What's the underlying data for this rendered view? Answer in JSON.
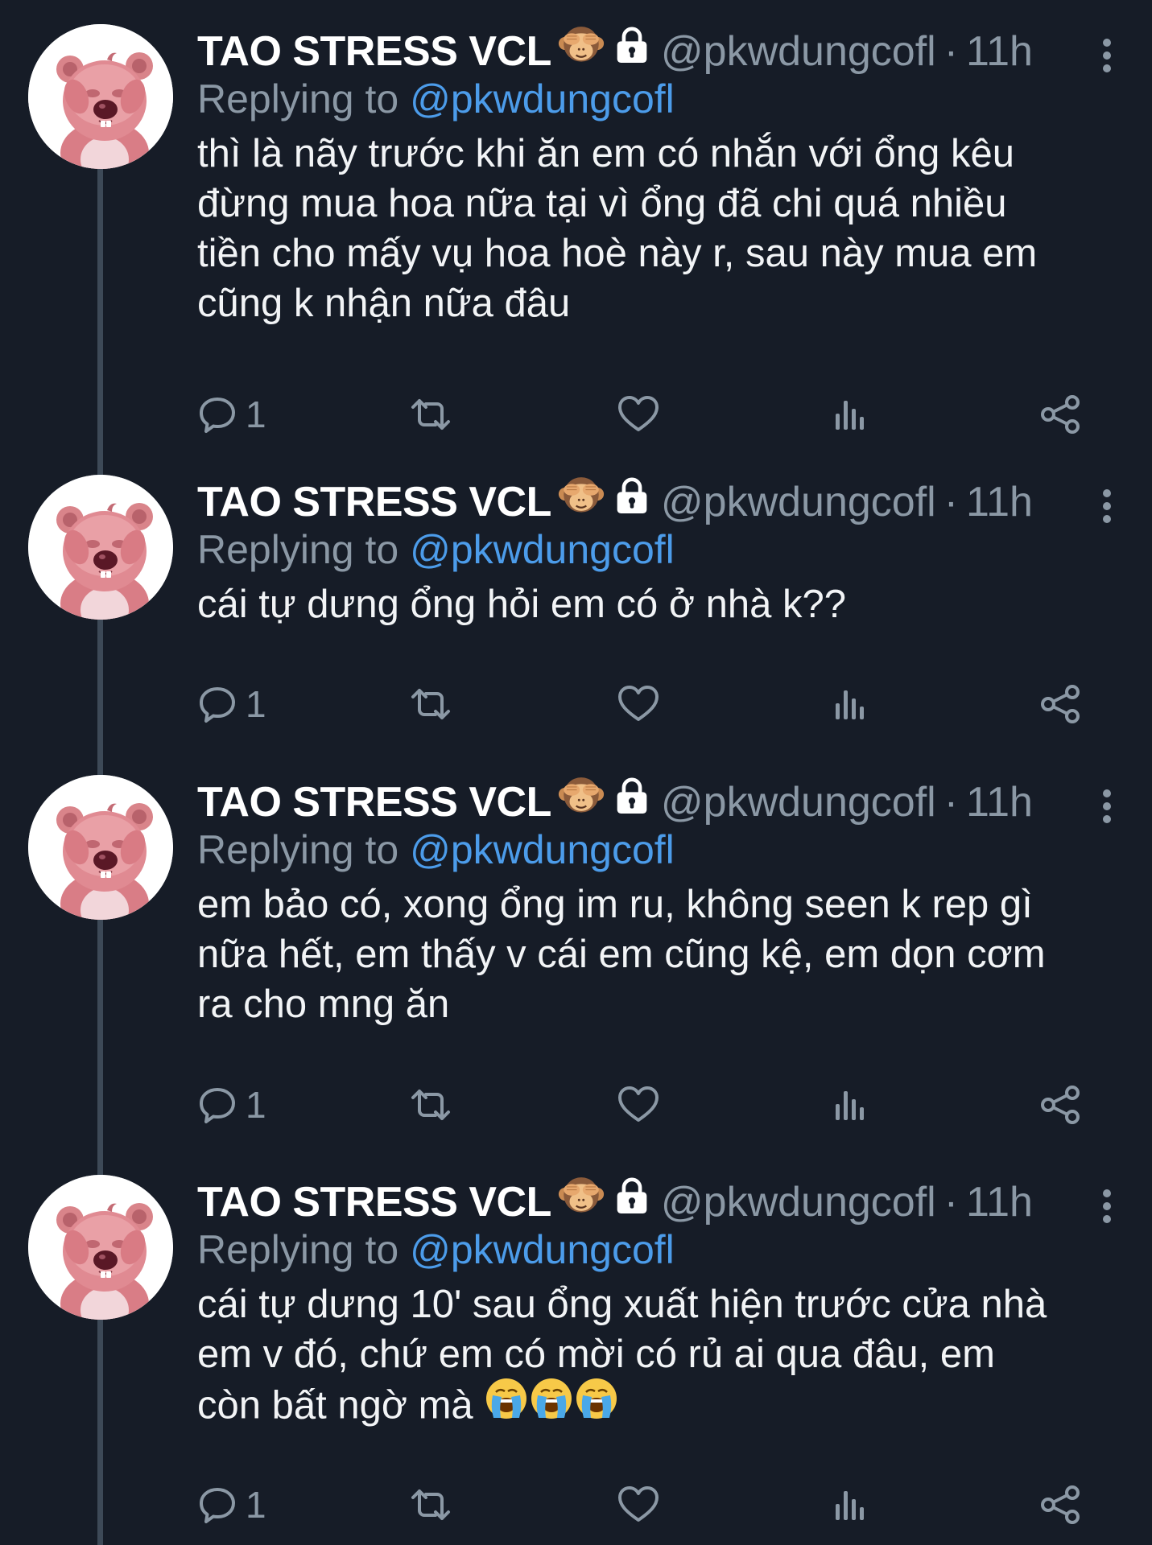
{
  "colors": {
    "background": "#161c27",
    "thread_line": "#3d4957",
    "secondary_text": "#8b98a5",
    "link": "#4c9cea",
    "primary_text": "#f2f4f6"
  },
  "tweets": [
    {
      "display_name": "TAO STRESS VCL",
      "name_emoji": "see-no-evil-monkey",
      "badge_icon": "lock-icon",
      "handle": "@pkwdungcofl",
      "separator": "·",
      "time": "11h",
      "reply_prefix": "Replying to",
      "reply_to": "@pkwdungcofl",
      "text": "thì là nãy trước khi ăn em có nhắn với ổng kêu\nđừng mua hoa nữa tại vì ổng đã chi quá nhiều\ntiền cho mấy vụ hoa hoè này r, sau này mua em\ncũng k nhận nữa đâu",
      "reply_count": "1"
    },
    {
      "display_name": "TAO STRESS VCL",
      "name_emoji": "see-no-evil-monkey",
      "badge_icon": "lock-icon",
      "handle": "@pkwdungcofl",
      "separator": "·",
      "time": "11h",
      "reply_prefix": "Replying to",
      "reply_to": "@pkwdungcofl",
      "text": "cái tự dưng ổng hỏi em có ở nhà k??",
      "reply_count": "1"
    },
    {
      "display_name": "TAO STRESS VCL",
      "name_emoji": "see-no-evil-monkey",
      "badge_icon": "lock-icon",
      "handle": "@pkwdungcofl",
      "separator": "·",
      "time": "11h",
      "reply_prefix": "Replying to",
      "reply_to": "@pkwdungcofl",
      "text": "em bảo có, xong ổng im ru, không seen k rep gì\nnữa hết, em thấy v cái em cũng kệ, em dọn cơm\nra cho mng ăn",
      "reply_count": "1"
    },
    {
      "display_name": "TAO STRESS VCL",
      "name_emoji": "see-no-evil-monkey",
      "badge_icon": "lock-icon",
      "handle": "@pkwdungcofl",
      "separator": "·",
      "time": "11h",
      "reply_prefix": "Replying to",
      "reply_to": "@pkwdungcofl",
      "text": "cái tự dưng 10' sau ổng xuất hiện trước cửa nhà\nem v đó, chứ em có mời có rủ ai qua đâu, em\ncòn bất ngờ mà ",
      "trailing_emoji": "loudly-crying-face x3",
      "reply_count": "1"
    }
  ],
  "action_icons": [
    "reply-icon",
    "retweet-icon",
    "like-icon",
    "views-icon",
    "share-icon"
  ]
}
